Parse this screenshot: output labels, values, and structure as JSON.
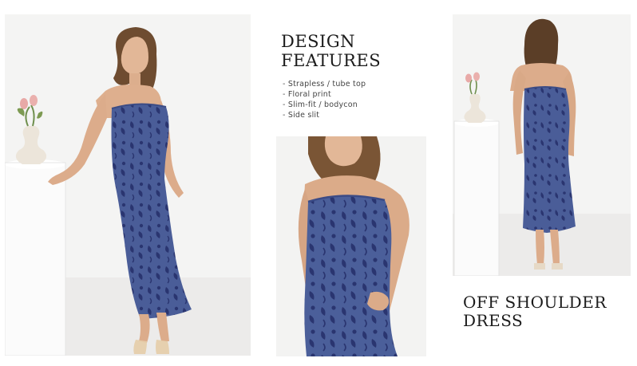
{
  "design_features": {
    "title_line1": "DESIGN",
    "title_line2": "FEATURES",
    "items": [
      "Strapless / tube top",
      "Floral print",
      "Slim-fit / bodycon",
      "Side slit"
    ]
  },
  "product": {
    "title_line1": "OFF SHOULDER",
    "title_line2": "DRESS"
  },
  "colors": {
    "dress_blue": "#4a5d98",
    "floral_navy": "#2a3570",
    "backdrop": "#f2f2f1"
  }
}
